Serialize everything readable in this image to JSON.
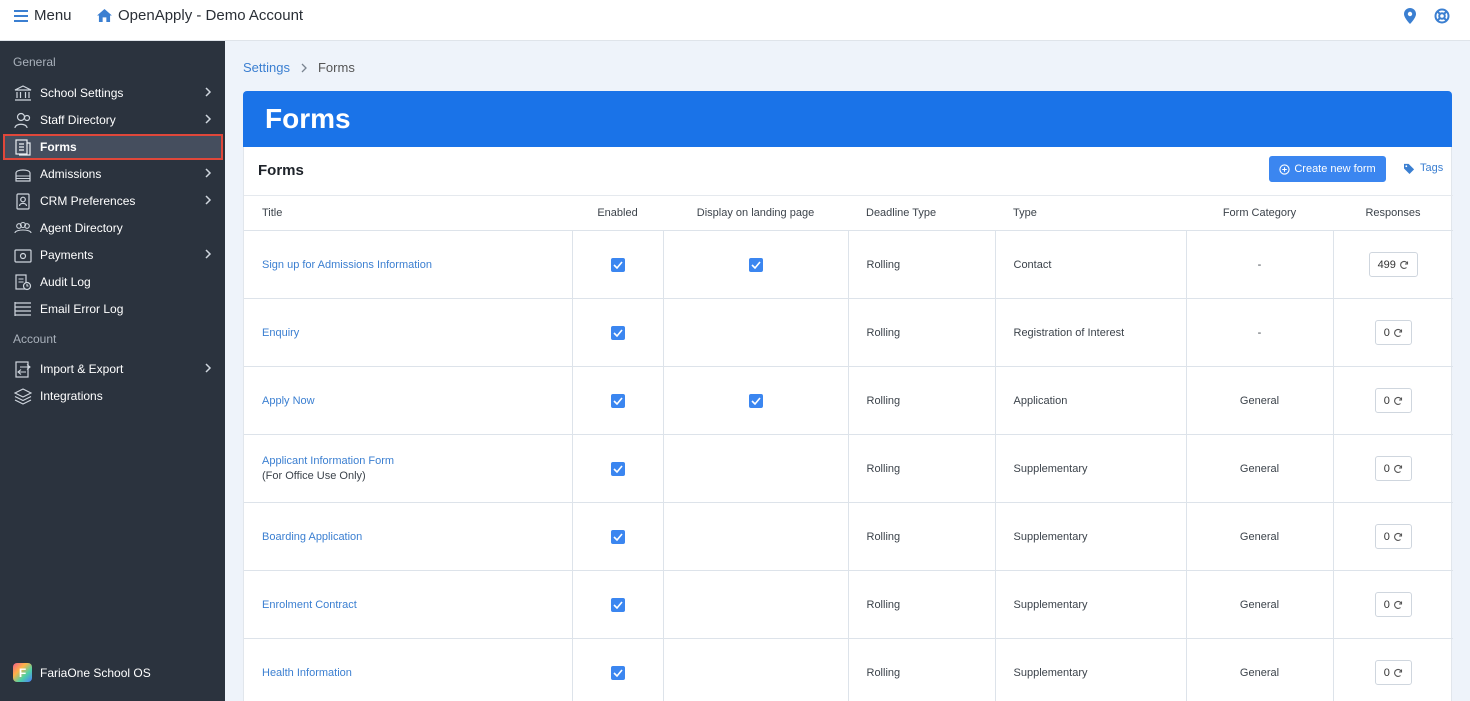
{
  "topbar": {
    "menu_label": "Menu",
    "app_title": "OpenApply - Demo Account"
  },
  "sidebar": {
    "general_label": "General",
    "account_label": "Account",
    "items": [
      {
        "label": "School Settings",
        "icon": "bank-icon",
        "has_children": true
      },
      {
        "label": "Staff Directory",
        "icon": "users-icon",
        "has_children": true
      },
      {
        "label": "Forms",
        "icon": "document-icon",
        "has_children": false,
        "active": true
      },
      {
        "label": "Admissions",
        "icon": "school-icon",
        "has_children": true
      },
      {
        "label": "CRM Preferences",
        "icon": "contacts-icon",
        "has_children": true
      },
      {
        "label": "Agent Directory",
        "icon": "group-icon",
        "has_children": false
      },
      {
        "label": "Payments",
        "icon": "payment-icon",
        "has_children": true
      },
      {
        "label": "Audit Log",
        "icon": "audit-icon",
        "has_children": false
      },
      {
        "label": "Email Error Log",
        "icon": "list-icon",
        "has_children": false
      }
    ],
    "account_items": [
      {
        "label": "Import & Export",
        "icon": "import-export-icon",
        "has_children": true
      },
      {
        "label": "Integrations",
        "icon": "layers-icon",
        "has_children": false
      }
    ],
    "brand": "FariaOne School OS",
    "brand_letter": "F"
  },
  "breadcrumb": {
    "parent": "Settings",
    "current": "Forms"
  },
  "banner_title": "Forms",
  "card": {
    "title": "Forms",
    "create_label": "Create new form",
    "tags_label": "Tags"
  },
  "table": {
    "headers": [
      "Title",
      "Enabled",
      "Display on landing page",
      "Deadline Type",
      "Type",
      "Form Category",
      "Responses"
    ],
    "rows": [
      {
        "title": "Sign up for Admissions Information",
        "subtitle": "",
        "enabled": true,
        "landing": true,
        "deadline": "Rolling",
        "type": "Contact",
        "category": "-",
        "responses": "499"
      },
      {
        "title": "Enquiry",
        "subtitle": "",
        "enabled": true,
        "landing": false,
        "deadline": "Rolling",
        "type": "Registration of Interest",
        "category": "-",
        "responses": "0"
      },
      {
        "title": "Apply Now",
        "subtitle": "",
        "enabled": true,
        "landing": true,
        "deadline": "Rolling",
        "type": "Application",
        "category": "General",
        "responses": "0"
      },
      {
        "title": "Applicant Information Form",
        "subtitle": "(For Office Use Only)",
        "enabled": true,
        "landing": false,
        "deadline": "Rolling",
        "type": "Supplementary",
        "category": "General",
        "responses": "0"
      },
      {
        "title": "Boarding Application",
        "subtitle": "",
        "enabled": true,
        "landing": false,
        "deadline": "Rolling",
        "type": "Supplementary",
        "category": "General",
        "responses": "0"
      },
      {
        "title": "Enrolment Contract",
        "subtitle": "",
        "enabled": true,
        "landing": false,
        "deadline": "Rolling",
        "type": "Supplementary",
        "category": "General",
        "responses": "0"
      },
      {
        "title": "Health Information",
        "subtitle": "",
        "enabled": true,
        "landing": false,
        "deadline": "Rolling",
        "type": "Supplementary",
        "category": "General",
        "responses": "0"
      }
    ]
  },
  "colors": {
    "accent": "#1a73e8",
    "sidebar_bg": "#2b333e",
    "active_outline": "#e0473a",
    "link": "#3b7fd1"
  }
}
